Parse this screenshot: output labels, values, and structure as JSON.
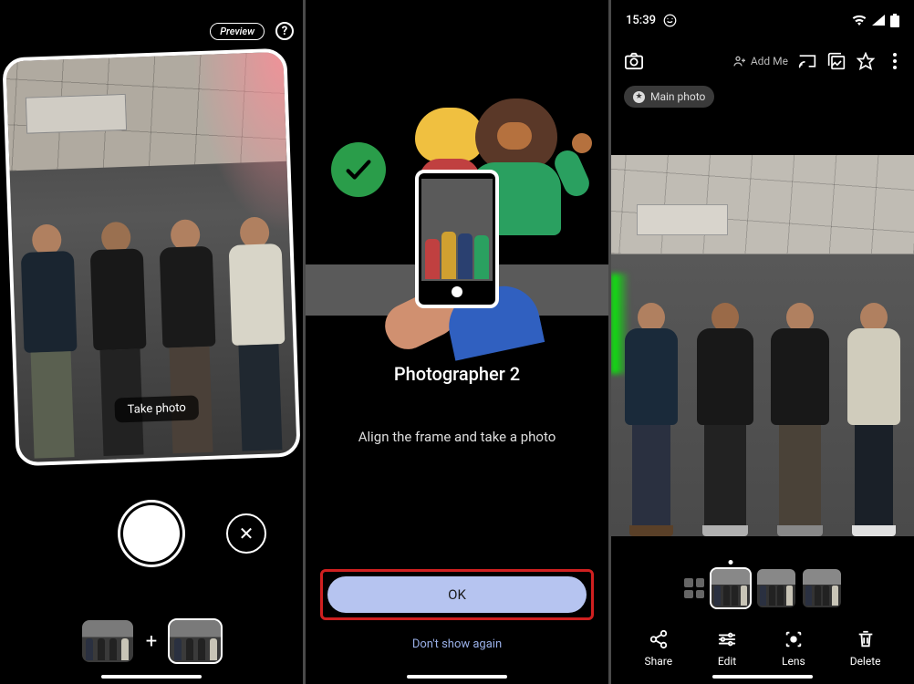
{
  "screen1": {
    "preview_label": "Preview",
    "take_photo_hint": "Take photo"
  },
  "screen2": {
    "title": "Photographer 2",
    "subtitle": "Align the frame and take a photo",
    "ok_label": "OK",
    "dont_show_label": "Don't show again"
  },
  "screen3": {
    "statusbar": {
      "time": "15:39"
    },
    "addme_label": "Add Me",
    "main_photo_chip": "Main photo",
    "actions": {
      "share": "Share",
      "edit": "Edit",
      "lens": "Lens",
      "delete": "Delete"
    }
  }
}
